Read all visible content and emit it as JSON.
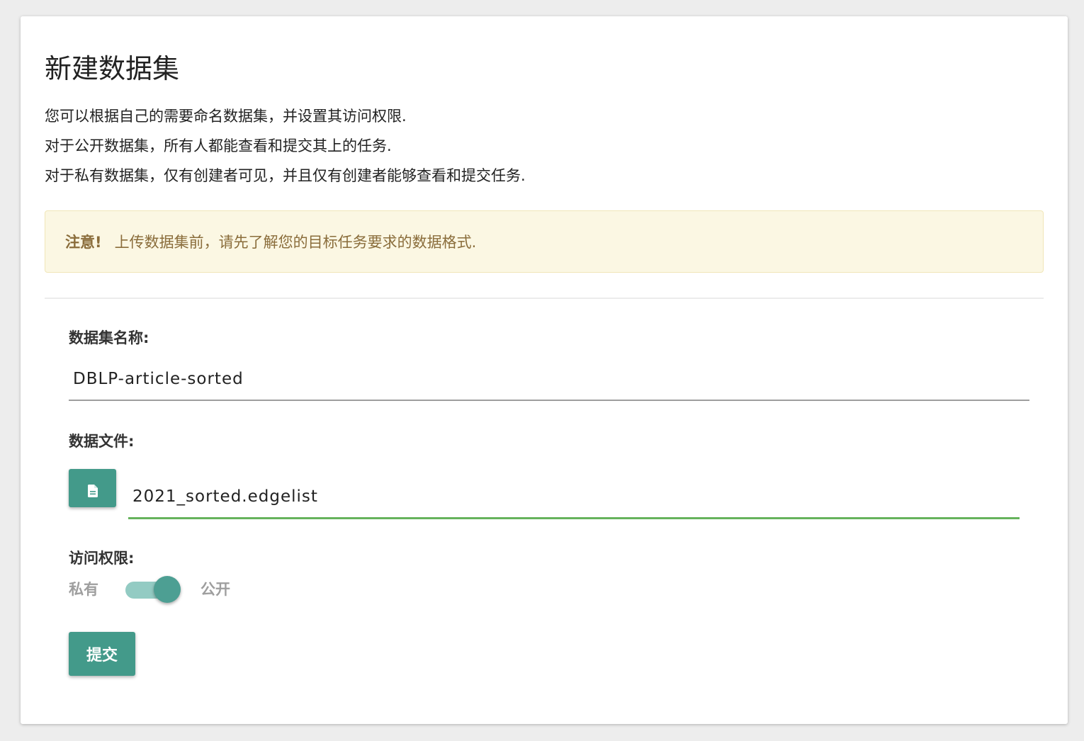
{
  "page": {
    "title": "新建数据集",
    "description": [
      "您可以根据自己的需要命名数据集，并设置其访问权限.",
      "对于公开数据集，所有人都能查看和提交其上的任务.",
      "对于私有数据集，仅有创建者可见，并且仅有创建者能够查看和提交任务."
    ]
  },
  "alert": {
    "label": "注意!",
    "text": "上传数据集前，请先了解您的目标任务要求的数据格式."
  },
  "form": {
    "name_label": "数据集名称:",
    "name_value": "DBLP-article-sorted",
    "file_label": "数据文件:",
    "file_icon": "file-icon",
    "file_value": "2021_sorted.edgelist",
    "access_label": "访问权限:",
    "access_private": "私有",
    "access_public": "公开",
    "access_is_public": true,
    "submit_label": "提交"
  },
  "colors": {
    "primary": "#439a8a",
    "switch_track": "#93cbc3",
    "file_underline": "#66b35c",
    "alert_bg": "#fbf7e3",
    "alert_text": "#8a6d3b"
  }
}
